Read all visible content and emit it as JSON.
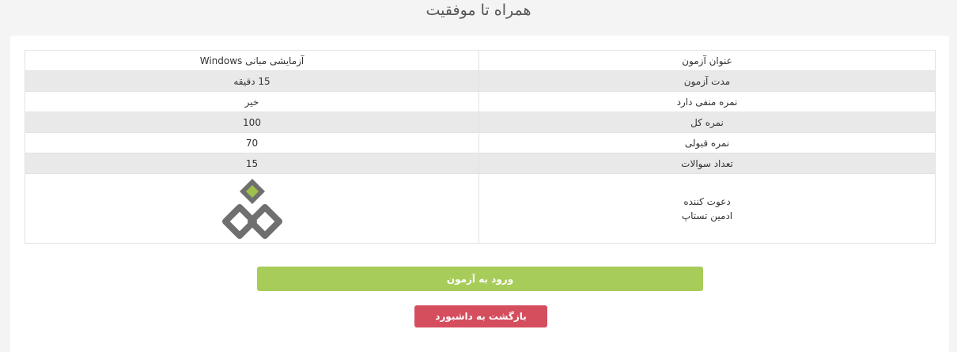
{
  "page": {
    "title": "همراه تا موفقیت"
  },
  "exam_info": {
    "rows": [
      {
        "label": "عنوان آزمون",
        "value": "آزمایشی مبانی Windows"
      },
      {
        "label": "مدت آزمون",
        "value": "15 دقیقه"
      },
      {
        "label": "نمره منفی دارد",
        "value": "خیر"
      },
      {
        "label": "نمره کل",
        "value": "100"
      },
      {
        "label": "نمره قبولی",
        "value": "70"
      },
      {
        "label": "تعداد سوالات",
        "value": "15"
      }
    ],
    "inviter": {
      "label": "دعوت کننده",
      "name": "ادمین تستاپ",
      "logo_icon": "organization-logo-icon"
    }
  },
  "actions": {
    "start_label": "ورود به آزمون",
    "back_label": "بازگشت به داشبورد"
  },
  "colors": {
    "start_button": "#a8cc5a",
    "back_button": "#d54e5e",
    "logo_green": "#9dc14b",
    "logo_gray": "#6f6f6f",
    "alt_row": "#e9e9e9"
  }
}
